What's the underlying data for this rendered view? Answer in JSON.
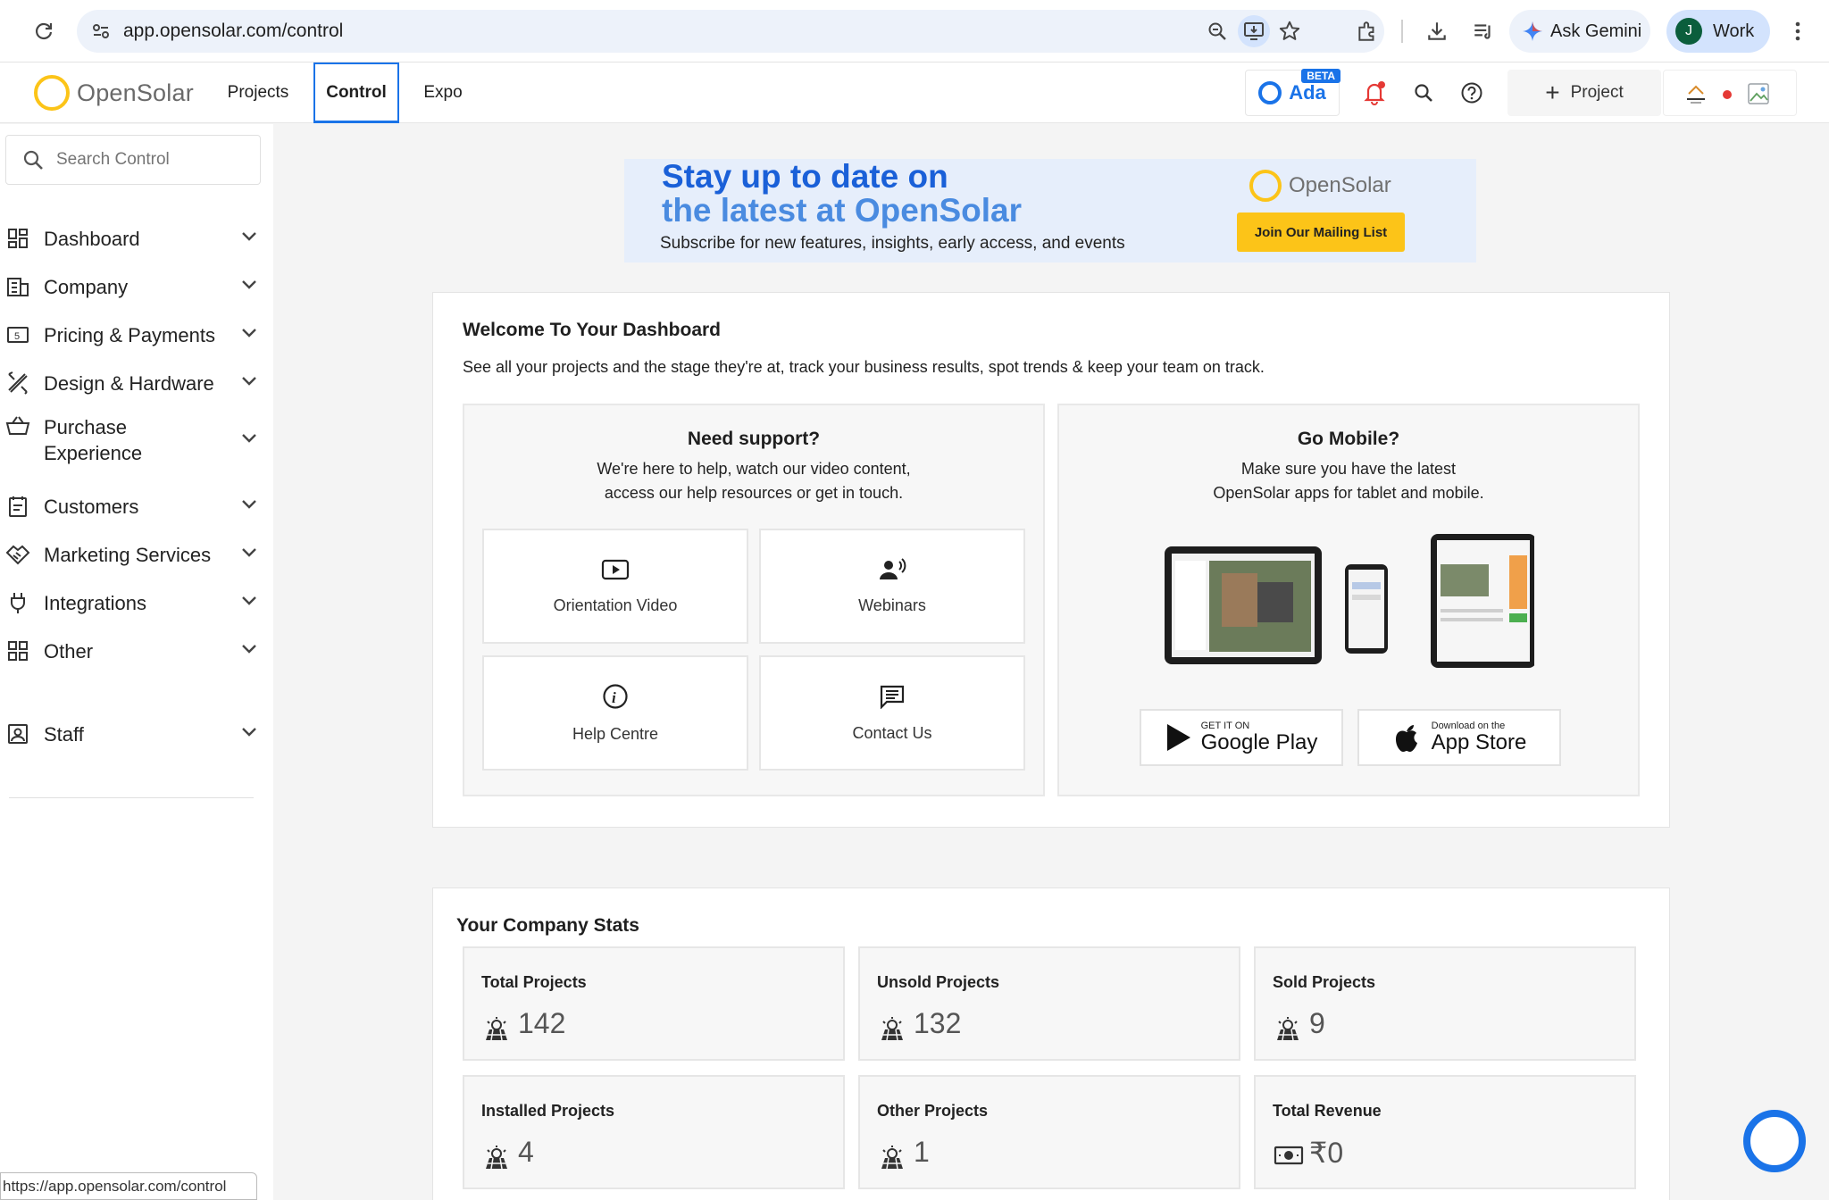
{
  "browser": {
    "url": "app.opensolar.com/control",
    "gemini_label": "Ask Gemini",
    "profile_initial": "J",
    "profile_label": "Work",
    "status_url": "https://app.opensolar.com/control"
  },
  "header": {
    "brand": "OpenSolar",
    "tabs": [
      {
        "label": "Projects"
      },
      {
        "label": "Control",
        "active": true
      },
      {
        "label": "Expo"
      }
    ],
    "ada_label": "Ada",
    "ada_badge": "BETA",
    "new_project_label": "Project"
  },
  "sidebar": {
    "search_placeholder": "Search Control",
    "items": [
      {
        "label": "Dashboard",
        "icon": "dashboard-icon"
      },
      {
        "label": "Company",
        "icon": "company-icon"
      },
      {
        "label": "Pricing & Payments",
        "icon": "pricing-icon"
      },
      {
        "label": "Design & Hardware",
        "icon": "design-icon"
      },
      {
        "label": "Purchase Experience",
        "icon": "basket-icon"
      },
      {
        "label": "Customers",
        "icon": "customers-icon"
      },
      {
        "label": "Marketing Services",
        "icon": "handshake-icon"
      },
      {
        "label": "Integrations",
        "icon": "plug-icon"
      },
      {
        "label": "Other",
        "icon": "grid-icon"
      },
      {
        "label": "Staff",
        "icon": "staff-icon"
      }
    ]
  },
  "banner": {
    "line1": "Stay up to date on",
    "line2": "the latest at OpenSolar",
    "subtitle": "Subscribe for new features, insights, early access, and events",
    "brand": "OpenSolar",
    "button": "Join Our Mailing List"
  },
  "welcome": {
    "title": "Welcome To Your Dashboard",
    "description": "See all your projects and the stage they're at, track your business results, spot trends & keep your team on track.",
    "support": {
      "title": "Need support?",
      "line1": "We're here to help, watch our video content,",
      "line2": "access our help resources or get in touch.",
      "tiles": [
        {
          "label": "Orientation Video",
          "icon": "play-video-icon"
        },
        {
          "label": "Webinars",
          "icon": "webinar-icon"
        },
        {
          "label": "Help Centre",
          "icon": "info-icon"
        },
        {
          "label": "Contact Us",
          "icon": "chat-icon"
        }
      ]
    },
    "mobile": {
      "title": "Go Mobile?",
      "line1": "Make sure you have the latest",
      "line2": "OpenSolar apps for tablet and mobile.",
      "google_small": "GET IT ON",
      "google_big": "Google Play",
      "apple_small": "Download on the",
      "apple_big": "App Store"
    }
  },
  "stats": {
    "title": "Your Company Stats",
    "items": [
      {
        "label": "Total Projects",
        "value": "142",
        "icon": "solar-panel-icon"
      },
      {
        "label": "Unsold Projects",
        "value": "132",
        "icon": "solar-panel-icon"
      },
      {
        "label": "Sold Projects",
        "value": "9",
        "icon": "solar-panel-icon"
      },
      {
        "label": "Installed Projects",
        "value": "4",
        "icon": "solar-panel-icon"
      },
      {
        "label": "Other Projects",
        "value": "1",
        "icon": "solar-panel-icon"
      },
      {
        "label": "Total Revenue",
        "value": "₹0",
        "icon": "cash-icon"
      }
    ]
  },
  "colors": {
    "accent": "#1a73e8",
    "brand_yellow": "#fcc418",
    "banner_bg": "#e6eefb"
  }
}
